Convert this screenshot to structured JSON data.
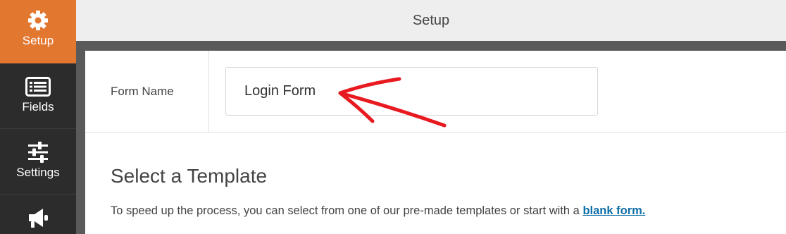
{
  "sidebar": {
    "items": [
      {
        "label": "Setup",
        "icon": "gear-icon",
        "active": true
      },
      {
        "label": "Fields",
        "icon": "fields-list-icon",
        "active": false
      },
      {
        "label": "Settings",
        "icon": "sliders-icon",
        "active": false
      },
      {
        "label": "",
        "icon": "megaphone-icon",
        "active": false
      }
    ]
  },
  "header": {
    "title": "Setup"
  },
  "form": {
    "name_label": "Form Name",
    "name_value": "Login Form"
  },
  "template": {
    "title": "Select a Template",
    "description": "To speed up the process, you can select from one of our pre-made templates or start with a ",
    "blank_link": "blank form."
  },
  "colors": {
    "accent": "#e27730",
    "sidebar_bg": "#2c2c2c",
    "link": "#0e6ea7",
    "annotation_arrow": "#e8191f"
  }
}
